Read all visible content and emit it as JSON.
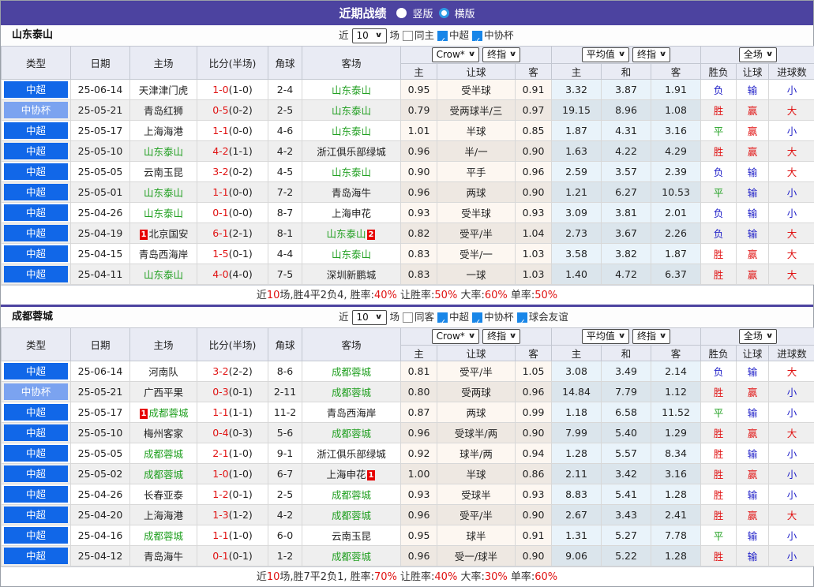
{
  "header": {
    "title": "近期战绩",
    "vertical_label": "竖版",
    "horizontal_label": "横版"
  },
  "dropdowns": {
    "crow": "Crow*",
    "final1": "终指",
    "avg": "平均值",
    "final2": "终指",
    "full": "全场"
  },
  "columns": {
    "type": "类型",
    "date": "日期",
    "home": "主场",
    "score": "比分(半场)",
    "corner": "角球",
    "away": "客场",
    "crow_sub": [
      "主",
      "让球",
      "客"
    ],
    "avg_sub": [
      "主",
      "和",
      "客"
    ],
    "full_sub": [
      "胜负",
      "让球",
      "进球数"
    ]
  },
  "colors": {
    "topbar_purple": "#4c43a0",
    "league_badge_blue": "#1167e8",
    "cup_badge_blue": "#7ba3f0",
    "win_red": "#e01212",
    "draw_green": "#1fa01f",
    "lose_blue": "#2020c8",
    "team_green": "#22a022"
  },
  "sections": [
    {
      "team": "山东泰山",
      "filter": {
        "near": "近",
        "count": "10",
        "games": "场",
        "same": "同主",
        "same_checked": false,
        "leagues": [
          {
            "label": "中超",
            "checked": true
          },
          {
            "label": "中协杯",
            "checked": true
          }
        ]
      },
      "rows": [
        {
          "type": "中超",
          "cup": false,
          "date": "25-06-14",
          "home": {
            "name": "天津津门虎",
            "green": false
          },
          "score": "1-0",
          "half": "(1-0)",
          "corners": "2-4",
          "away": {
            "name": "山东泰山",
            "green": true
          },
          "odds": [
            "0.95",
            "受半球",
            "0.91"
          ],
          "avg": [
            "3.32",
            "3.87",
            "1.91"
          ],
          "outcome": [
            [
              "负",
              "b"
            ],
            [
              "输",
              "b"
            ],
            [
              "小",
              "b"
            ]
          ]
        },
        {
          "type": "中协杯",
          "cup": true,
          "date": "25-05-21",
          "home": {
            "name": "青岛红狮",
            "green": false
          },
          "score": "0-5",
          "half": "(0-2)",
          "corners": "2-5",
          "away": {
            "name": "山东泰山",
            "green": true
          },
          "odds": [
            "0.79",
            "受两球半/三",
            "0.97"
          ],
          "avg": [
            "19.15",
            "8.96",
            "1.08"
          ],
          "outcome": [
            [
              "胜",
              "r"
            ],
            [
              "赢",
              "r"
            ],
            [
              "大",
              "r"
            ]
          ]
        },
        {
          "type": "中超",
          "cup": false,
          "date": "25-05-17",
          "home": {
            "name": "上海海港",
            "green": false
          },
          "score": "1-1",
          "half": "(0-0)",
          "corners": "4-6",
          "away": {
            "name": "山东泰山",
            "green": true
          },
          "odds": [
            "1.01",
            "半球",
            "0.85"
          ],
          "avg": [
            "1.87",
            "4.31",
            "3.16"
          ],
          "outcome": [
            [
              "平",
              "g"
            ],
            [
              "赢",
              "r"
            ],
            [
              "小",
              "b"
            ]
          ]
        },
        {
          "type": "中超",
          "cup": false,
          "date": "25-05-10",
          "home": {
            "name": "山东泰山",
            "green": true
          },
          "score": "4-2",
          "half": "(1-1)",
          "corners": "4-2",
          "away": {
            "name": "浙江俱乐部绿城",
            "green": false
          },
          "odds": [
            "0.96",
            "半/一",
            "0.90"
          ],
          "avg": [
            "1.63",
            "4.22",
            "4.29"
          ],
          "outcome": [
            [
              "胜",
              "r"
            ],
            [
              "赢",
              "r"
            ],
            [
              "大",
              "r"
            ]
          ]
        },
        {
          "type": "中超",
          "cup": false,
          "date": "25-05-05",
          "home": {
            "name": "云南玉昆",
            "green": false
          },
          "score": "3-2",
          "half": "(0-2)",
          "corners": "4-5",
          "away": {
            "name": "山东泰山",
            "green": true
          },
          "odds": [
            "0.90",
            "平手",
            "0.96"
          ],
          "avg": [
            "2.59",
            "3.57",
            "2.39"
          ],
          "outcome": [
            [
              "负",
              "b"
            ],
            [
              "输",
              "b"
            ],
            [
              "大",
              "r"
            ]
          ]
        },
        {
          "type": "中超",
          "cup": false,
          "date": "25-05-01",
          "home": {
            "name": "山东泰山",
            "green": true
          },
          "score": "1-1",
          "half": "(0-0)",
          "corners": "7-2",
          "away": {
            "name": "青岛海牛",
            "green": false
          },
          "odds": [
            "0.96",
            "两球",
            "0.90"
          ],
          "avg": [
            "1.21",
            "6.27",
            "10.53"
          ],
          "outcome": [
            [
              "平",
              "g"
            ],
            [
              "输",
              "b"
            ],
            [
              "小",
              "b"
            ]
          ]
        },
        {
          "type": "中超",
          "cup": false,
          "date": "25-04-26",
          "home": {
            "name": "山东泰山",
            "green": true
          },
          "score": "0-1",
          "half": "(0-0)",
          "corners": "8-7",
          "away": {
            "name": "上海申花",
            "green": false
          },
          "odds": [
            "0.93",
            "受半球",
            "0.93"
          ],
          "avg": [
            "3.09",
            "3.81",
            "2.01"
          ],
          "outcome": [
            [
              "负",
              "b"
            ],
            [
              "输",
              "b"
            ],
            [
              "小",
              "b"
            ]
          ]
        },
        {
          "type": "中超",
          "cup": false,
          "date": "25-04-19",
          "home": {
            "name": "北京国安",
            "green": false,
            "badge": "1",
            "badge_pos": "before"
          },
          "score": "6-1",
          "half": "(2-1)",
          "corners": "8-1",
          "away": {
            "name": "山东泰山",
            "green": true,
            "badge": "2",
            "badge_pos": "after"
          },
          "odds": [
            "0.82",
            "受平/半",
            "1.04"
          ],
          "avg": [
            "2.73",
            "3.67",
            "2.26"
          ],
          "outcome": [
            [
              "负",
              "b"
            ],
            [
              "输",
              "b"
            ],
            [
              "大",
              "r"
            ]
          ]
        },
        {
          "type": "中超",
          "cup": false,
          "date": "25-04-15",
          "home": {
            "name": "青岛西海岸",
            "green": false
          },
          "score": "1-5",
          "half": "(0-1)",
          "corners": "4-4",
          "away": {
            "name": "山东泰山",
            "green": true
          },
          "odds": [
            "0.83",
            "受半/一",
            "1.03"
          ],
          "avg": [
            "3.58",
            "3.82",
            "1.87"
          ],
          "outcome": [
            [
              "胜",
              "r"
            ],
            [
              "赢",
              "r"
            ],
            [
              "大",
              "r"
            ]
          ]
        },
        {
          "type": "中超",
          "cup": false,
          "date": "25-04-11",
          "home": {
            "name": "山东泰山",
            "green": true
          },
          "score": "4-0",
          "half": "(4-0)",
          "corners": "7-5",
          "away": {
            "name": "深圳新鹏城",
            "green": false
          },
          "odds": [
            "0.83",
            "一球",
            "1.03"
          ],
          "avg": [
            "1.40",
            "4.72",
            "6.37"
          ],
          "outcome": [
            [
              "胜",
              "r"
            ],
            [
              "赢",
              "r"
            ],
            [
              "大",
              "r"
            ]
          ]
        }
      ],
      "summary": [
        [
          "近",
          "k"
        ],
        [
          "10",
          "r"
        ],
        [
          "场,胜4平2负4, 胜率:",
          "k"
        ],
        [
          "40%",
          "r"
        ],
        [
          " 让胜率:",
          "k"
        ],
        [
          "50%",
          "r"
        ],
        [
          " 大率:",
          "k"
        ],
        [
          "60%",
          "r"
        ],
        [
          " 单率:",
          "k"
        ],
        [
          "50%",
          "r"
        ]
      ]
    },
    {
      "team": "成都蓉城",
      "filter": {
        "near": "近",
        "count": "10",
        "games": "场",
        "same": "同客",
        "same_checked": false,
        "leagues": [
          {
            "label": "中超",
            "checked": true
          },
          {
            "label": "中协杯",
            "checked": true
          },
          {
            "label": "球会友谊",
            "checked": true
          }
        ]
      },
      "rows": [
        {
          "type": "中超",
          "cup": false,
          "date": "25-06-14",
          "home": {
            "name": "河南队",
            "green": false
          },
          "score": "3-2",
          "half": "(2-2)",
          "corners": "8-6",
          "away": {
            "name": "成都蓉城",
            "green": true
          },
          "odds": [
            "0.81",
            "受平/半",
            "1.05"
          ],
          "avg": [
            "3.08",
            "3.49",
            "2.14"
          ],
          "outcome": [
            [
              "负",
              "b"
            ],
            [
              "输",
              "b"
            ],
            [
              "大",
              "r"
            ]
          ]
        },
        {
          "type": "中协杯",
          "cup": true,
          "date": "25-05-21",
          "home": {
            "name": "广西平果",
            "green": false
          },
          "score": "0-3",
          "half": "(0-1)",
          "corners": "2-11",
          "away": {
            "name": "成都蓉城",
            "green": true
          },
          "odds": [
            "0.80",
            "受两球",
            "0.96"
          ],
          "avg": [
            "14.84",
            "7.79",
            "1.12"
          ],
          "outcome": [
            [
              "胜",
              "r"
            ],
            [
              "赢",
              "r"
            ],
            [
              "小",
              "b"
            ]
          ]
        },
        {
          "type": "中超",
          "cup": false,
          "date": "25-05-17",
          "home": {
            "name": "成都蓉城",
            "green": true,
            "badge": "1",
            "badge_pos": "before"
          },
          "score": "1-1",
          "half": "(1-1)",
          "corners": "11-2",
          "away": {
            "name": "青岛西海岸",
            "green": false
          },
          "odds": [
            "0.87",
            "两球",
            "0.99"
          ],
          "avg": [
            "1.18",
            "6.58",
            "11.52"
          ],
          "outcome": [
            [
              "平",
              "g"
            ],
            [
              "输",
              "b"
            ],
            [
              "小",
              "b"
            ]
          ]
        },
        {
          "type": "中超",
          "cup": false,
          "date": "25-05-10",
          "home": {
            "name": "梅州客家",
            "green": false
          },
          "score": "0-4",
          "half": "(0-3)",
          "corners": "5-6",
          "away": {
            "name": "成都蓉城",
            "green": true
          },
          "odds": [
            "0.96",
            "受球半/两",
            "0.90"
          ],
          "avg": [
            "7.99",
            "5.40",
            "1.29"
          ],
          "outcome": [
            [
              "胜",
              "r"
            ],
            [
              "赢",
              "r"
            ],
            [
              "大",
              "r"
            ]
          ]
        },
        {
          "type": "中超",
          "cup": false,
          "date": "25-05-05",
          "home": {
            "name": "成都蓉城",
            "green": true
          },
          "score": "2-1",
          "half": "(1-0)",
          "corners": "9-1",
          "away": {
            "name": "浙江俱乐部绿城",
            "green": false
          },
          "odds": [
            "0.92",
            "球半/两",
            "0.94"
          ],
          "avg": [
            "1.28",
            "5.57",
            "8.34"
          ],
          "outcome": [
            [
              "胜",
              "r"
            ],
            [
              "输",
              "b"
            ],
            [
              "小",
              "b"
            ]
          ]
        },
        {
          "type": "中超",
          "cup": false,
          "date": "25-05-02",
          "home": {
            "name": "成都蓉城",
            "green": true
          },
          "score": "1-0",
          "half": "(1-0)",
          "corners": "6-7",
          "away": {
            "name": "上海申花",
            "green": false,
            "badge": "1",
            "badge_pos": "after"
          },
          "odds": [
            "1.00",
            "半球",
            "0.86"
          ],
          "avg": [
            "2.11",
            "3.42",
            "3.16"
          ],
          "outcome": [
            [
              "胜",
              "r"
            ],
            [
              "赢",
              "r"
            ],
            [
              "小",
              "b"
            ]
          ]
        },
        {
          "type": "中超",
          "cup": false,
          "date": "25-04-26",
          "home": {
            "name": "长春亚泰",
            "green": false
          },
          "score": "1-2",
          "half": "(0-1)",
          "corners": "2-5",
          "away": {
            "name": "成都蓉城",
            "green": true
          },
          "odds": [
            "0.93",
            "受球半",
            "0.93"
          ],
          "avg": [
            "8.83",
            "5.41",
            "1.28"
          ],
          "outcome": [
            [
              "胜",
              "r"
            ],
            [
              "输",
              "b"
            ],
            [
              "小",
              "b"
            ]
          ]
        },
        {
          "type": "中超",
          "cup": false,
          "date": "25-04-20",
          "home": {
            "name": "上海海港",
            "green": false
          },
          "score": "1-3",
          "half": "(1-2)",
          "corners": "4-2",
          "away": {
            "name": "成都蓉城",
            "green": true
          },
          "odds": [
            "0.96",
            "受平/半",
            "0.90"
          ],
          "avg": [
            "2.67",
            "3.43",
            "2.41"
          ],
          "outcome": [
            [
              "胜",
              "r"
            ],
            [
              "赢",
              "r"
            ],
            [
              "大",
              "r"
            ]
          ]
        },
        {
          "type": "中超",
          "cup": false,
          "date": "25-04-16",
          "home": {
            "name": "成都蓉城",
            "green": true
          },
          "score": "1-1",
          "half": "(1-0)",
          "corners": "6-0",
          "away": {
            "name": "云南玉昆",
            "green": false
          },
          "odds": [
            "0.95",
            "球半",
            "0.91"
          ],
          "avg": [
            "1.31",
            "5.27",
            "7.78"
          ],
          "outcome": [
            [
              "平",
              "g"
            ],
            [
              "输",
              "b"
            ],
            [
              "小",
              "b"
            ]
          ]
        },
        {
          "type": "中超",
          "cup": false,
          "date": "25-04-12",
          "home": {
            "name": "青岛海牛",
            "green": false
          },
          "score": "0-1",
          "half": "(0-1)",
          "corners": "1-2",
          "away": {
            "name": "成都蓉城",
            "green": true
          },
          "odds": [
            "0.96",
            "受一/球半",
            "0.90"
          ],
          "avg": [
            "9.06",
            "5.22",
            "1.28"
          ],
          "outcome": [
            [
              "胜",
              "r"
            ],
            [
              "输",
              "b"
            ],
            [
              "小",
              "b"
            ]
          ]
        }
      ],
      "summary": [
        [
          "近",
          "k"
        ],
        [
          "10",
          "r"
        ],
        [
          "场,胜7平2负1, 胜率:",
          "k"
        ],
        [
          "70%",
          "r"
        ],
        [
          " 让胜率:",
          "k"
        ],
        [
          "40%",
          "r"
        ],
        [
          " 大率:",
          "k"
        ],
        [
          "30%",
          "r"
        ],
        [
          " 单率:",
          "k"
        ],
        [
          "60%",
          "r"
        ]
      ]
    }
  ]
}
